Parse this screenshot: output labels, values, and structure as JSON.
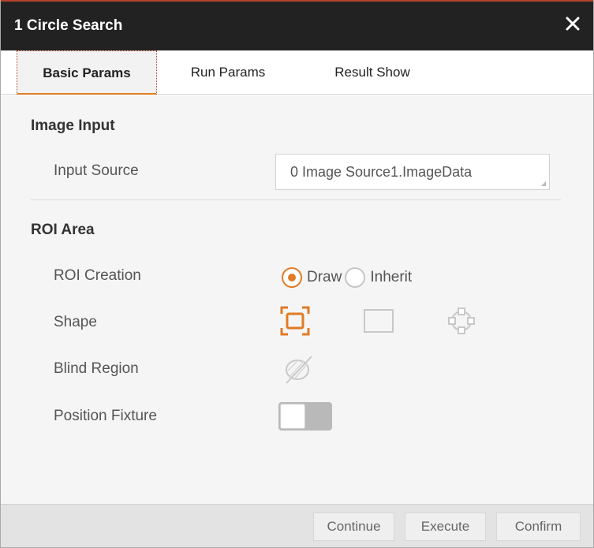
{
  "window": {
    "title": "1 Circle Search",
    "close_icon": "close-icon"
  },
  "tabs": [
    {
      "label": "Basic Params",
      "active": true
    },
    {
      "label": "Run Params",
      "active": false
    },
    {
      "label": "Result Show",
      "active": false
    }
  ],
  "image_input": {
    "section_title": "Image Input",
    "input_source_label": "Input Source",
    "input_source_value": "0 Image Source1.ImageData"
  },
  "roi_area": {
    "section_title": "ROI Area",
    "roi_creation_label": "ROI Creation",
    "roi_creation_options": [
      {
        "label": "Draw",
        "selected": true
      },
      {
        "label": "Inherit",
        "selected": false
      }
    ],
    "shape_label": "Shape",
    "shape_options": [
      {
        "icon": "circle-roi-shape-icon",
        "selected": true
      },
      {
        "icon": "rectangle-shape-icon",
        "selected": false
      },
      {
        "icon": "point-set-shape-icon",
        "selected": false
      }
    ],
    "blind_region_label": "Blind Region",
    "blind_region_icon": "blind-region-icon",
    "position_fixture_label": "Position Fixture",
    "position_fixture_on": false
  },
  "footer": {
    "continue_label": "Continue",
    "execute_label": "Execute",
    "confirm_label": "Confirm"
  },
  "colors": {
    "accent": "#e07b25",
    "titlebar": "#222222",
    "panel": "#f5f5f5",
    "footer": "#e3e3e3"
  }
}
